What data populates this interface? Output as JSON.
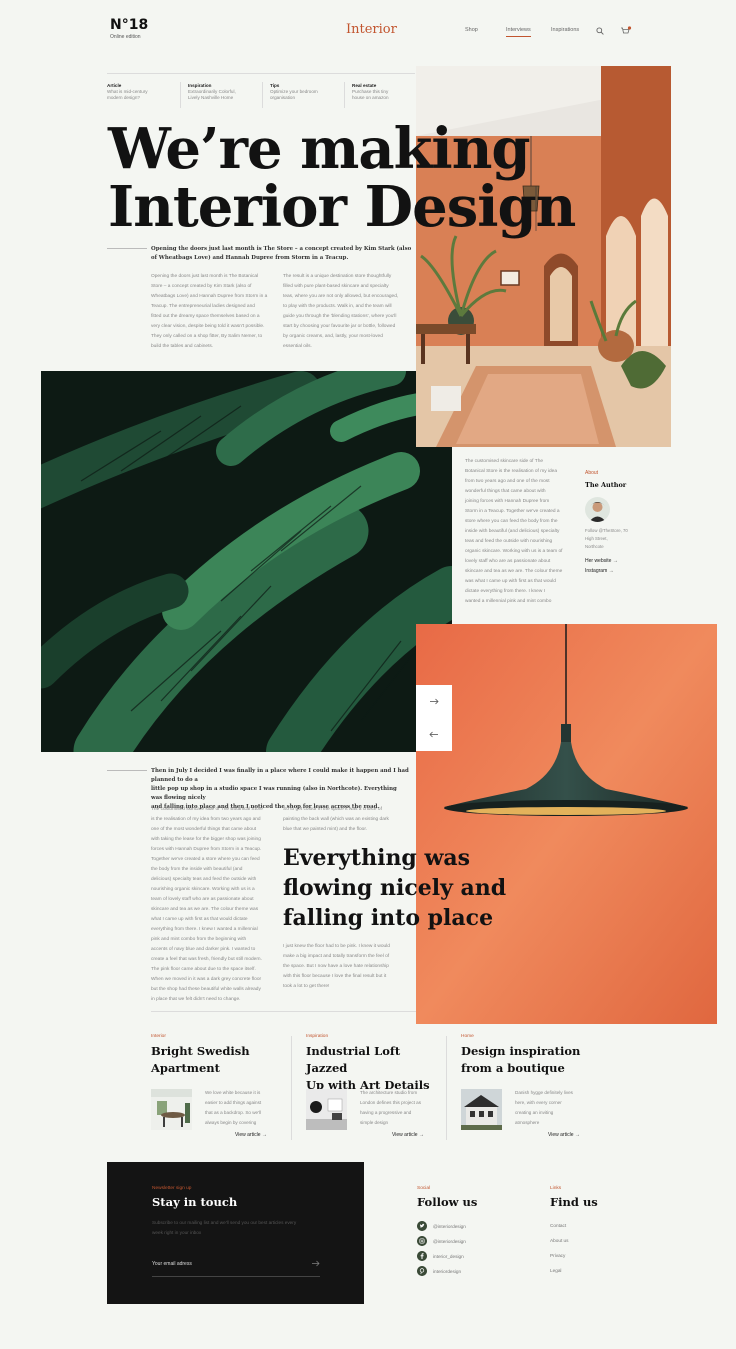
{
  "header": {
    "issue": "N°18",
    "edition": "Online edition",
    "brand": "Interior",
    "nav": [
      "Shop",
      "Interviews",
      "Inspirations"
    ]
  },
  "strip": [
    {
      "category": "Article",
      "text_1": "What is mid-century",
      "text_2": "modern design?"
    },
    {
      "category": "Inspiration",
      "text_1": "Extraordinarily Colorful,",
      "text_2": "Lively Nashville Home"
    },
    {
      "category": "Tips",
      "text_1": "Optimize your bedroom",
      "text_2": "organisation"
    },
    {
      "category": "Real estate",
      "text_1": "Purchase this tiny",
      "text_2": "house on amazon"
    }
  ],
  "hero": {
    "line1": "We’re making",
    "line2": "Interior Design",
    "lede": "Opening the doors just last month is The Store – a concept created by Kim Stark (also of Wheatbags Love) and Hannah Dupree from Storm in a Teacup.",
    "col1": [
      "Opening the doors just last month is The Botanical",
      "Store – a concept created by Kim Stark (also of",
      "Wheatbags Love) and Hannah Dupree from Storm in a",
      "Teacup. The entrepreneurial ladies designed and",
      "fitted out the dreamy space themselves based on a",
      "very clear vision, despite being told it wasn't possible.",
      "They only called on a shop fitter, By Salim Nemer, to",
      "build the tables and cabinets."
    ],
    "col2": [
      "The result is a unique destination store thoughtfully",
      "filled with pure plant-based skincare and specialty",
      "teas, where you are not only allowed, but encouraged,",
      "to play with the products. Walk in, and the team will",
      "guide you through the 'blending stations', where you'll",
      "start by choosing your favourite jar or bottle, followed",
      "by organic creams, and, lastly, your most-loved",
      "essential oils."
    ]
  },
  "side_text": [
    "The customised skincare side of The",
    "Botanical Store is the realisation of my idea",
    "from two years ago and one of the most",
    "wonderful things that came about with",
    "joining forces with Hannah Dupree from",
    "Storm in a Teacup. Together we've created a",
    "store where you can feed the body from the",
    "inside with beautiful (and delicious) specialty",
    "teas and feed the outside with nourishing",
    "organic skincare. Working with us is a team of",
    "lovely staff who are as passionate about",
    "skincare and tea as we are. The colour theme",
    "was what I came up with first as that would",
    "dictate everything from there. I knew I",
    "wanted a millennial pink and mint combo"
  ],
  "author": {
    "heading": "About",
    "title": "The Author",
    "meta": [
      "Follow @TheStore, 70",
      "High Street,",
      "Northcote"
    ],
    "website": "Her website",
    "instagram": "Instagram"
  },
  "section2": {
    "lede": [
      "Then in July I decided I was finally in a place where I could make it happen and I had planned to do a",
      "little pop up shop in a studio space I was running (also in Northcote). Everything was flowing nicely",
      "and falling into place and then I noticed the shop for lease across the road."
    ],
    "col1": [
      "The customised skincare side of The Botanical Store",
      "is the realisation of my idea from two years ago and",
      "one of the most wonderful things that came about",
      "with taking the lease for the bigger shop was joining",
      "forces with Hannah Dupree from Storm in a Teacup.",
      "Together we've created a store where you can feed",
      "the body from the inside with beautiful (and",
      "delicious) specialty teas and feed the outside with",
      "nourishing organic skincare. Working with us is a",
      "team of lovely staff who are as passionate about",
      "skincare and tea as we are. The colour theme was",
      "what I came up with first as that would dictate",
      "everything from there. I knew I wanted a millennial",
      "pink and mint combo from the beginning with",
      "accents of navy blue and darker pink. I wanted to",
      "create a feel that was fresh, friendly but still modern.",
      "The pink floor came about due to the space itself.",
      "When we moved in it was a dark grey concrete floor",
      "but the shop had these beautiful white walls already",
      "in place that we felt didn't need to change."
    ],
    "col2_top": [
      "So to get colour in the space it was a choice of",
      "painting the back wall (which was an existing dark",
      "blue that we painted mint) and the floor."
    ],
    "quote": [
      "Everything was",
      "flowing nicely and",
      "falling into place"
    ],
    "col2_bottom": [
      "I just knew the floor had to be pink. I knew it would",
      "make a big impact and totally transform the feel of",
      "the space. But I now have a love hate relationship",
      "with this floor because I love the final result but it",
      "took a lot to get there!"
    ]
  },
  "cards": [
    {
      "category": "Interior",
      "title_1": "Bright Swedish",
      "title_2": "Apartment",
      "text": [
        "We love white because it is",
        "easier to add things against",
        "that as a backdrop. So we'll",
        "always begin by covering"
      ],
      "link": "View article"
    },
    {
      "category": "Inspiration",
      "title_1": "Industrial Loft Jazzed",
      "title_2": "Up with Art Details",
      "text": [
        "The architecture studio from",
        "London defines this project as",
        "having a progressive and",
        "simple design"
      ],
      "link": "View article"
    },
    {
      "category": "Home",
      "title_1": "Design inspiration",
      "title_2": "from a boutique",
      "text": [
        "Danish hygge definitely lives",
        "here, with every corner",
        "creating an inviting",
        "atmosphere"
      ],
      "link": "View article"
    }
  ],
  "newsletter": {
    "category": "Newsletter sign up",
    "title": "Stay in touch",
    "desc_1": "Subscribe to our mailing list and we'll send you our best articles every",
    "desc_2": "week right in your inbox",
    "placeholder": "Your email adress"
  },
  "social": {
    "category": "Social",
    "title": "Follow us",
    "items": [
      "@interiordesign",
      "@interiordesign",
      "interior_design",
      "interiordesign"
    ]
  },
  "links": {
    "category": "Links",
    "title": "Find us",
    "items": [
      "Contact",
      "About us",
      "Privacy",
      "Legal"
    ]
  },
  "colors": {
    "accent": "#c2552f",
    "ink": "#121212",
    "background": "#f4f6f2",
    "dark": "#141414"
  }
}
